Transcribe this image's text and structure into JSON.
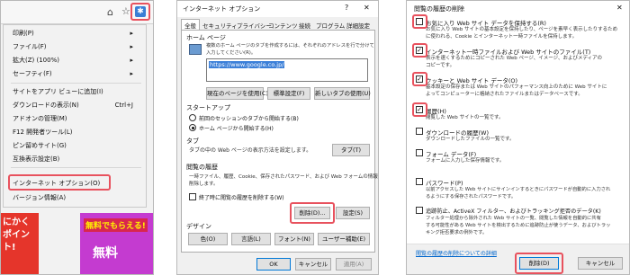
{
  "menu": {
    "items": [
      {
        "label": "印刷(P)",
        "shortcut": "▸"
      },
      {
        "label": "ファイル(F)",
        "shortcut": "▸"
      },
      {
        "label": "拡大(Z) (100%)",
        "shortcut": "▸"
      },
      {
        "label": "セーフティ(F)",
        "shortcut": "▸"
      },
      {
        "label": "サイトをアプリ ビューに追加(I)",
        "shortcut": ""
      },
      {
        "label": "ダウンロードの表示(N)",
        "shortcut": "Ctrl+J"
      },
      {
        "label": "アドオンの管理(M)",
        "shortcut": ""
      },
      {
        "label": "F12 開発者ツール(L)",
        "shortcut": ""
      },
      {
        "label": "ピン留めサイト(G)",
        "shortcut": ""
      },
      {
        "label": "互換表示設定(B)",
        "shortcut": ""
      },
      {
        "label": "インターネット オプション(O)",
        "shortcut": ""
      },
      {
        "label": "バージョン情報(A)",
        "shortcut": ""
      }
    ],
    "banner_left": "にかく ポイント!",
    "banner_right_top": "無料でもらえる!",
    "banner_right_bottom": "無料"
  },
  "options_dialog": {
    "title": "インターネット オプション",
    "help_icon": "?",
    "close_icon": "✕",
    "tabs": [
      "全般",
      "セキュリティ",
      "プライバシー",
      "コンテンツ",
      "接続",
      "プログラム",
      "詳細設定"
    ],
    "home_group": "ホーム ページ",
    "home_desc_1": "複数のホーム ページのタブを作成するには、それぞれのアドレスを行で分けて",
    "home_desc_2": "入力してください(R)。",
    "home_url": "https://www.google.co.jp/",
    "btn_use_current": "現在のページを使用(C)",
    "btn_use_default": "標準設定(F)",
    "btn_new_tab": "新しいタブの使用(U)",
    "startup_group": "スタートアップ",
    "startup_opt1": "前回のセッションのタブから開始する(B)",
    "startup_opt2": "ホーム ページから開始する(H)",
    "tabs_group": "タブ",
    "tabs_desc": "タブの中の Web ページの表示方法を設定します。",
    "btn_tabs": "タブ(T)",
    "history_group": "閲覧の履歴",
    "history_desc_1": "一時ファイル、履歴、Cookie、保存されたパスワード、および Web フォームの情報を",
    "history_desc_2": "削除します。",
    "history_exit_cb": "終了時に閲覧の履歴を削除する(W)",
    "btn_delete": "削除(D)...",
    "btn_settings": "設定(S)",
    "design_group": "デザイン",
    "btn_color": "色(O)",
    "btn_language": "言語(L)",
    "btn_font": "フォント(N)",
    "btn_accessibility": "ユーザー補助(E)",
    "btn_ok": "OK",
    "btn_cancel": "キャンセル",
    "btn_apply": "適用(A)"
  },
  "delete_dialog": {
    "title": "閲覧の履歴の削除",
    "close_icon": "✕",
    "items": [
      {
        "label": "お気に入り Web サイト データを保持する(R)",
        "checked": false,
        "desc": [
          "お気に入り Web サイトの基本設定を保持したり、ページを素早く表示したりするため",
          "に使われる、Cookie とインターネット一時ファイルを保持します。"
        ]
      },
      {
        "label": "インターネット一時ファイルおよび Web サイトのファイル(T)",
        "checked": true,
        "desc": [
          "表示を速くするためにコピーされた Web ページ、イメージ、およびメディアの",
          "コピーです。"
        ]
      },
      {
        "label": "クッキーと Web サイト データ(O)",
        "checked": true,
        "desc": [
          "基本設定の保存または Web サイトのパフォーマンス向上のために Web サイトに",
          "よってコンピューターに格納されたファイルまたはデータベースです。"
        ]
      },
      {
        "label": "履歴(H)",
        "checked": true,
        "desc": [
          "閲覧した Web サイトの一覧です。"
        ]
      },
      {
        "label": "ダウンロードの履歴(W)",
        "checked": false,
        "desc": [
          "ダウンロードしたファイルの一覧です。"
        ]
      },
      {
        "label": "フォーム データ(F)",
        "checked": false,
        "desc": [
          "フォームに入力した保存情報です。"
        ]
      },
      {
        "label": "パスワード(P)",
        "checked": false,
        "desc": [
          "以前アクセスした Web サイトにサインインするときにパスワードが自動的に入力され",
          "るようにする保存されたパスワードです。"
        ]
      },
      {
        "label": "追跡防止、ActiveX フィルター、およびトラッキング拒否のデータ(K)",
        "checked": false,
        "desc": [
          "フィルター処理から除外された Web サイトの一覧、閲覧した情報を自動的に共有",
          "する可能性がある Web サイトを検出するために追跡防止が使うデータ、およびトラッ",
          "キング拒否要求の例外です。"
        ]
      }
    ],
    "link": "閲覧の履歴の削除についての詳細",
    "btn_delete": "削除(D)",
    "btn_cancel": "キャンセル"
  }
}
